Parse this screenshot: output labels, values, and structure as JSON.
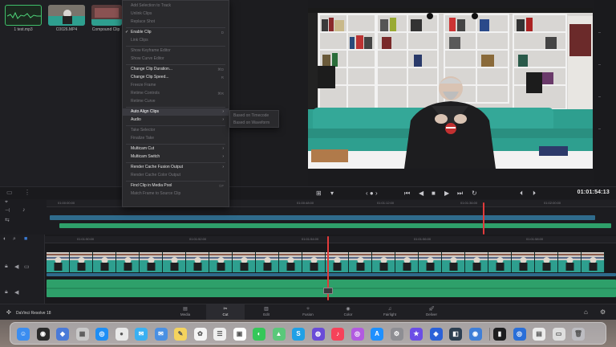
{
  "media_pool": {
    "clips": [
      {
        "name": "1 test.mp3"
      },
      {
        "name": "C0026.MP4"
      },
      {
        "name": "Compound Clip"
      }
    ]
  },
  "context_menu": {
    "items": [
      {
        "label": "Add Selection to Track",
        "shortcut": "",
        "disabled": true,
        "checked": false,
        "submenu": false
      },
      {
        "label": "Unlink Clips",
        "shortcut": "",
        "disabled": true,
        "checked": false,
        "submenu": false
      },
      {
        "label": "Replace Shot",
        "shortcut": "",
        "disabled": true,
        "checked": false,
        "submenu": false
      },
      {
        "label": "Enable Clip",
        "shortcut": "D",
        "disabled": false,
        "checked": true,
        "submenu": false
      },
      {
        "label": "Link Clips",
        "shortcut": "",
        "disabled": true,
        "checked": false,
        "submenu": false
      },
      {
        "label": "Show Keyframe Editor",
        "shortcut": "",
        "disabled": true,
        "checked": false,
        "submenu": false
      },
      {
        "label": "Show Curve Editor",
        "shortcut": "",
        "disabled": true,
        "checked": false,
        "submenu": false
      },
      {
        "label": "Change Clip Duration...",
        "shortcut": "⌘D",
        "disabled": false,
        "checked": false,
        "submenu": false
      },
      {
        "label": "Change Clip Speed...",
        "shortcut": "R",
        "disabled": false,
        "checked": false,
        "submenu": false
      },
      {
        "label": "Freeze Frame",
        "shortcut": "",
        "disabled": true,
        "checked": false,
        "submenu": false
      },
      {
        "label": "Retime Controls",
        "shortcut": "⌘R",
        "disabled": true,
        "checked": false,
        "submenu": false
      },
      {
        "label": "Retime Curve",
        "shortcut": "",
        "disabled": true,
        "checked": false,
        "submenu": false
      },
      {
        "label": "Auto Align Clips",
        "shortcut": "",
        "disabled": false,
        "checked": false,
        "submenu": true,
        "highlighted": true
      },
      {
        "label": "Audio",
        "shortcut": "",
        "disabled": false,
        "checked": false,
        "submenu": true
      },
      {
        "label": "Take Selector",
        "shortcut": "",
        "disabled": true,
        "checked": false,
        "submenu": false
      },
      {
        "label": "Finalize Take",
        "shortcut": "",
        "disabled": true,
        "checked": false,
        "submenu": false
      },
      {
        "label": "Multicam Cut",
        "shortcut": "",
        "disabled": false,
        "checked": false,
        "submenu": true
      },
      {
        "label": "Multicam Switch",
        "shortcut": "",
        "disabled": false,
        "checked": false,
        "submenu": true
      },
      {
        "label": "Render Cache Fusion Output",
        "shortcut": "",
        "disabled": false,
        "checked": false,
        "submenu": true
      },
      {
        "label": "Render Cache Color Output",
        "shortcut": "",
        "disabled": true,
        "checked": false,
        "submenu": false
      },
      {
        "label": "Find Clip in Media Pool",
        "shortcut": "⇧F",
        "disabled": false,
        "checked": false,
        "submenu": false
      },
      {
        "label": "Match Frame to Source Clip",
        "shortcut": "",
        "disabled": true,
        "checked": false,
        "submenu": false
      }
    ],
    "submenu": [
      "Based on Timecode",
      "Based on Waveform"
    ]
  },
  "viewer": {
    "timecode": "01:01:54:13"
  },
  "upper_timeline": {
    "ticks": [
      "01:00:00:00",
      "01:00:24:00",
      "01:00:48:00",
      "01:01:12:00",
      "01:01:36:00",
      "01:02:00:00"
    ]
  },
  "lower_timeline": {
    "ticks": [
      "01:01:50:00",
      "01:01:52:00",
      "01:01:54:00",
      "01:01:56:00",
      "01:01:58:00"
    ]
  },
  "page_tabs": {
    "app_name": "DaVinci Resolve 18",
    "tabs": [
      {
        "label": "Media",
        "icon": "media-icon"
      },
      {
        "label": "Cut",
        "icon": "cut-icon",
        "active": true
      },
      {
        "label": "Edit",
        "icon": "edit-icon"
      },
      {
        "label": "Fusion",
        "icon": "fusion-icon"
      },
      {
        "label": "Color",
        "icon": "color-icon"
      },
      {
        "label": "Fairlight",
        "icon": "fairlight-icon"
      },
      {
        "label": "Deliver",
        "icon": "deliver-icon"
      }
    ]
  },
  "colors": {
    "video_track": "#2f6b8c",
    "audio_track": "#2ea06a",
    "playhead": "#e23b3b",
    "sofa": "#2e9f8f"
  },
  "dock": {
    "apps": [
      "finder",
      "siri",
      "safari-like",
      "launchpad",
      "safari",
      "chrome",
      "messages-blue",
      "mail",
      "notes",
      "photos",
      "reminders",
      "calendar",
      "facetime",
      "maps",
      "skype",
      "dvd",
      "music",
      "podcasts",
      "app-store",
      "settings",
      "imovie",
      "nordvpn",
      "davinci",
      "preview",
      "terminal",
      "quicktime",
      "documents",
      "files",
      "trash"
    ]
  }
}
